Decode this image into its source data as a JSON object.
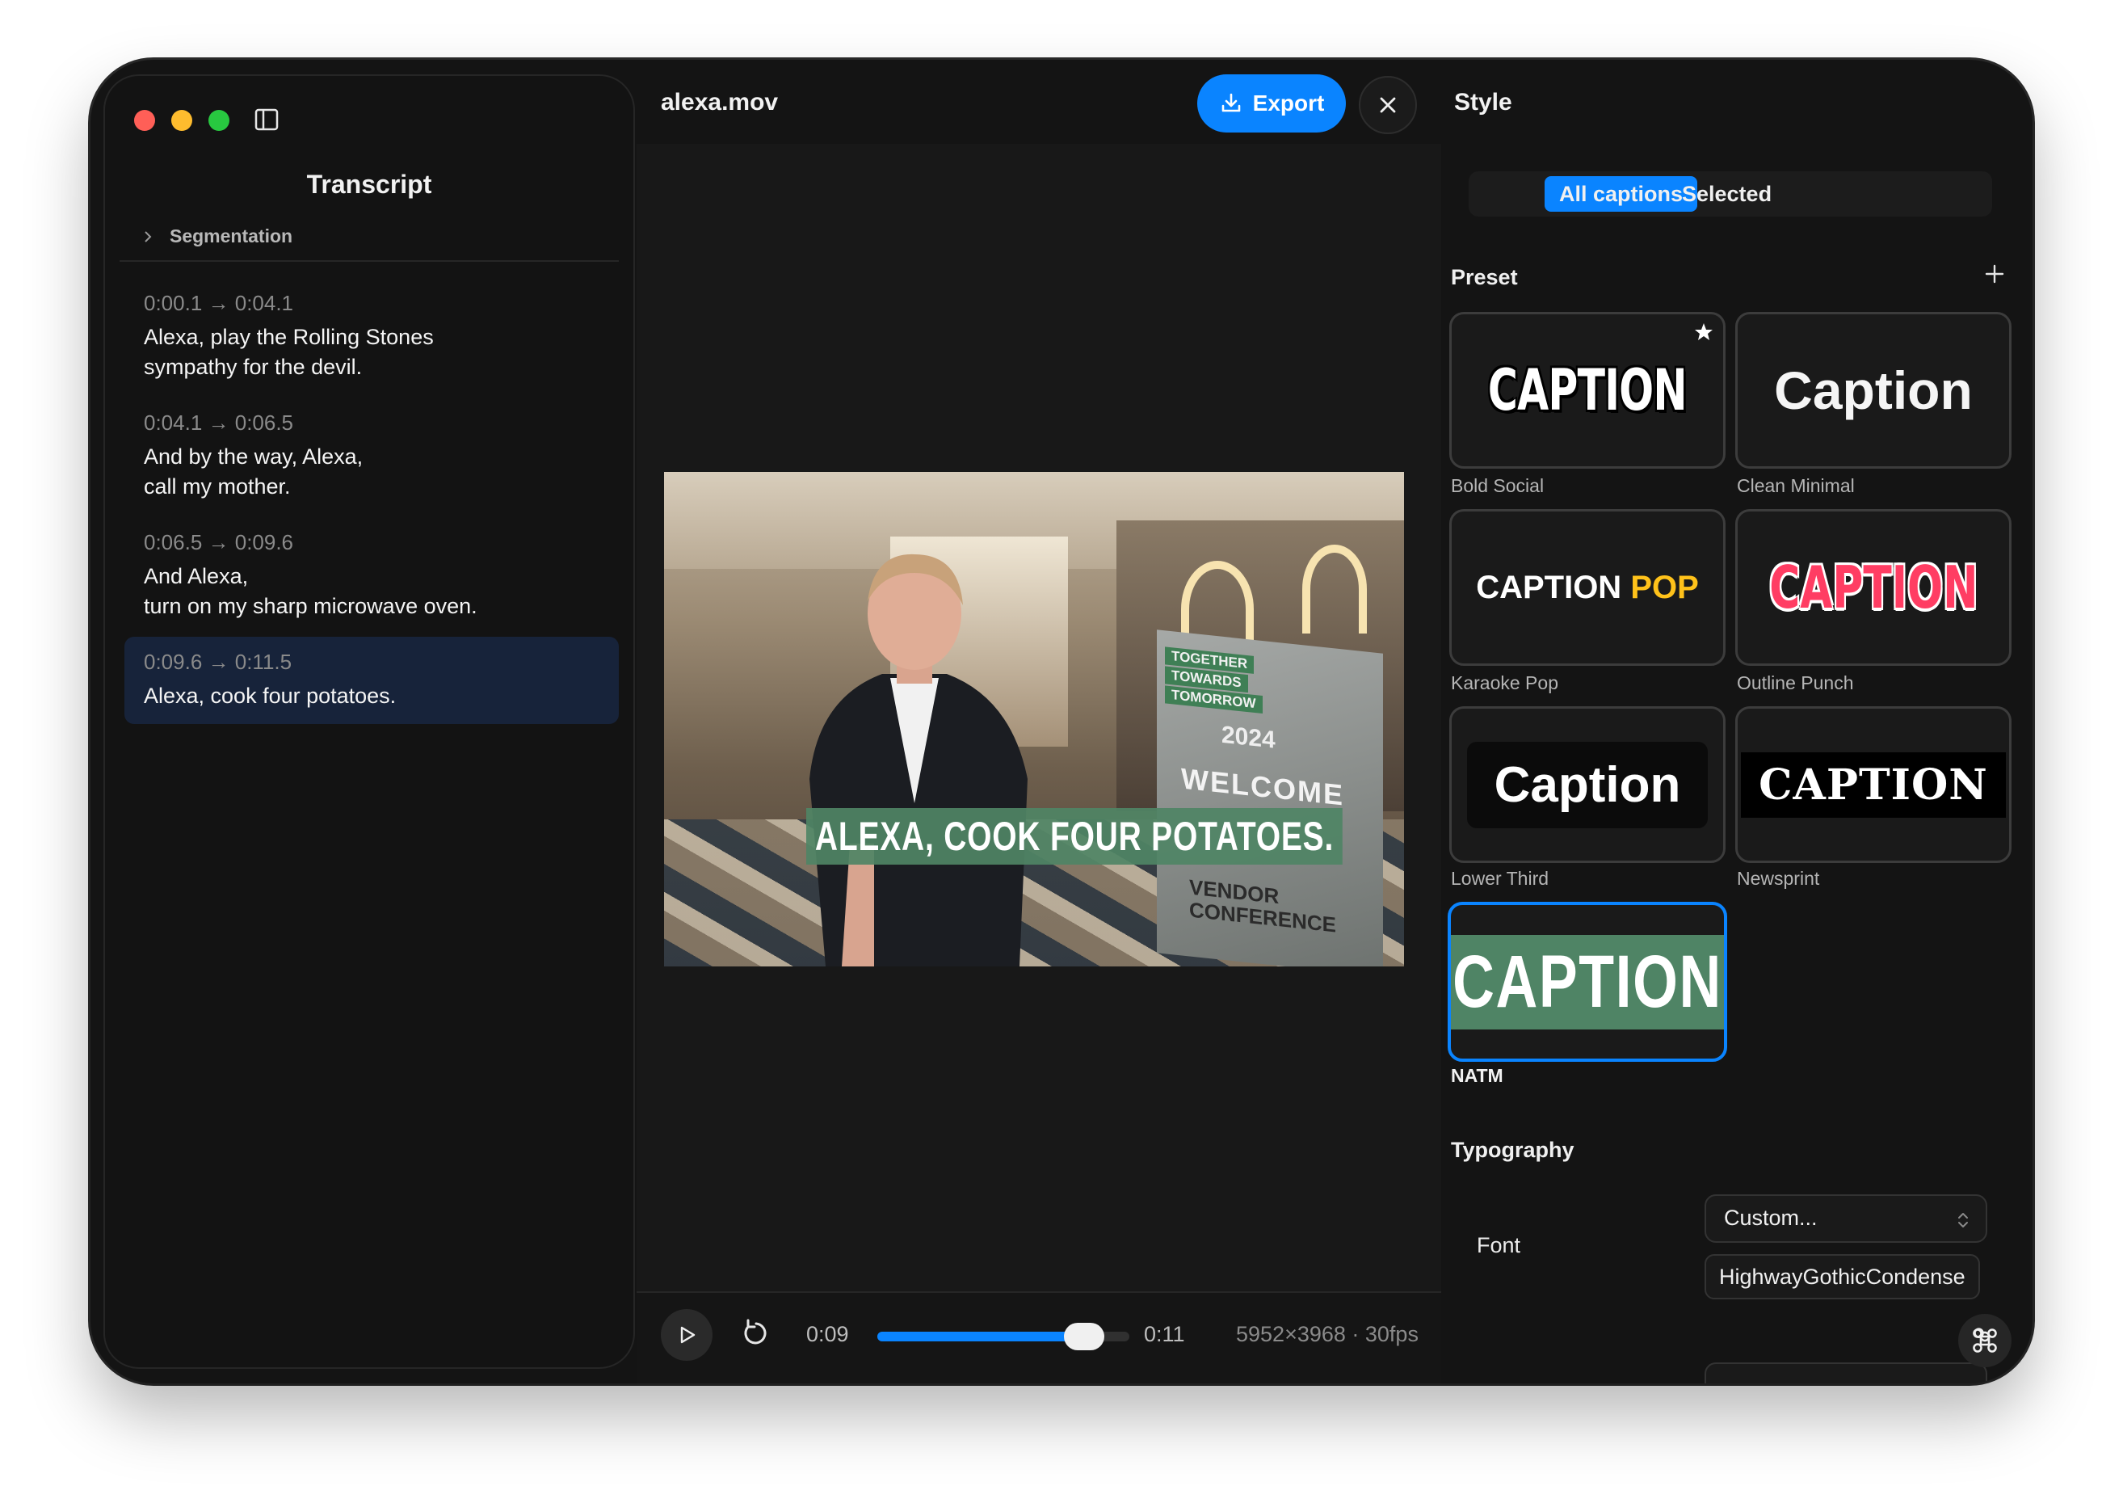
{
  "sidebar": {
    "title": "Transcript",
    "segmentation_label": "Segmentation",
    "entries": [
      {
        "time": "0:00.1 → 0:04.1",
        "text": "Alexa, play the Rolling Stones\nsympathy for the devil."
      },
      {
        "time": "0:04.1 → 0:06.5",
        "text": "And by the way, Alexa,\ncall my mother."
      },
      {
        "time": "0:06.5 → 0:09.6",
        "text": "And Alexa,\nturn on my sharp microwave oven."
      },
      {
        "time": "0:09.6 → 0:11.5",
        "text": "Alexa, cook four potatoes."
      }
    ],
    "active_entry_index": 3
  },
  "header": {
    "file_name": "alexa.mov",
    "export_label": "Export"
  },
  "video": {
    "caption_text": "ALEXA, COOK FOUR POTATOES.",
    "sign": {
      "tags": [
        "TOGETHER",
        "TOWARDS",
        "TOMORROW"
      ],
      "year": "2024",
      "welcome": "WELCOME",
      "bottom": "VENDOR\nCONFERENCE"
    }
  },
  "player": {
    "current_time": "0:09",
    "duration": "0:11",
    "progress_fraction": 0.82,
    "meta": "5952×3968 · 30fps"
  },
  "style_panel": {
    "title": "Style",
    "scope_options": [
      "All captions",
      "Selected"
    ],
    "scope_selected": "All captions",
    "preset_label": "Preset",
    "presets": [
      {
        "name": "Bold Social",
        "sample": "CAPTION",
        "favorite": true
      },
      {
        "name": "Clean Minimal",
        "sample": "Caption"
      },
      {
        "name": "Karaoke Pop",
        "sample_a": "CAPTION",
        "sample_b": "POP"
      },
      {
        "name": "Outline Punch",
        "sample": "CAPTION"
      },
      {
        "name": "Lower Third",
        "sample": "Caption"
      },
      {
        "name": "Newsprint",
        "sample": "CAPTION"
      },
      {
        "name": "NATM",
        "sample": "CAPTION",
        "selected": true
      }
    ],
    "typography_label": "Typography",
    "font_label": "Font",
    "font_select_value": "Custom...",
    "font_name": "HighwayGothicCondense"
  },
  "colors": {
    "accent": "#0a84ff",
    "caption_bg": "#4f8465",
    "karaoke_highlight": "#ffc21a",
    "outline_punch": "#ff3d63"
  }
}
